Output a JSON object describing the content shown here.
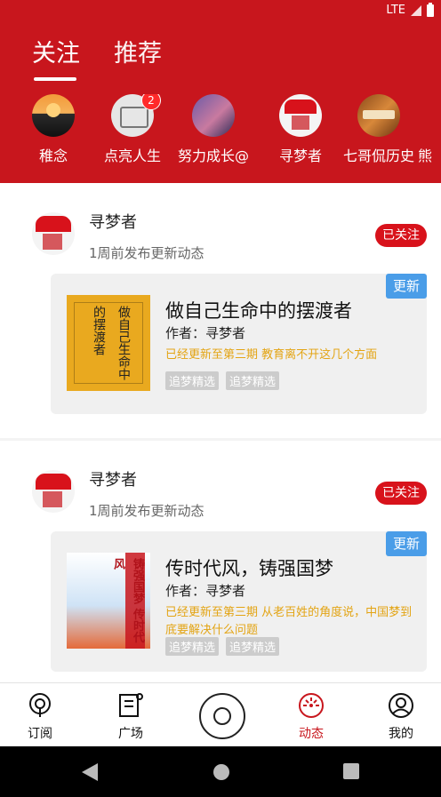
{
  "status": {
    "network": "LTE"
  },
  "tabs": [
    {
      "label": "关注"
    },
    {
      "label": "推荐"
    }
  ],
  "following": [
    {
      "name": "稚念"
    },
    {
      "name": "点亮人生",
      "badge": "2"
    },
    {
      "name": "努力成长@"
    },
    {
      "name": "寻梦者"
    },
    {
      "name": "七哥侃历史"
    },
    {
      "name": "熊"
    }
  ],
  "posts": [
    {
      "user": "寻梦者",
      "time": "1周前发布更新动态",
      "follow_label": "已关注",
      "update_label": "更新",
      "cover_text": "做自己生命中的摆渡者",
      "title": "做自己生命中的摆渡者",
      "author": "作者：寻梦者",
      "desc": "已经更新至第三期   教育离不开这几个方面",
      "tags": [
        "追梦精选",
        "追梦精选"
      ]
    },
    {
      "user": "寻梦者",
      "time": "1周前发布更新动态",
      "follow_label": "已关注",
      "update_label": "更新",
      "cover_text": "铸强国梦 传时代风",
      "title": "传时代风，铸强国梦",
      "author": "作者：寻梦者",
      "desc": "已经更新至第三期   从老百姓的角度说，中国梦到底要解决什么问题",
      "tags": [
        "追梦精选",
        "追梦精选"
      ]
    }
  ],
  "bottom_nav": [
    {
      "label": "订阅",
      "icon": "podcast-icon"
    },
    {
      "label": "广场",
      "icon": "list-icon"
    },
    {
      "label": "",
      "icon": "disc-icon"
    },
    {
      "label": "动态",
      "icon": "activity-icon",
      "active": true
    },
    {
      "label": "我的",
      "icon": "profile-icon"
    }
  ],
  "colors": {
    "brand": "#c8161d",
    "update": "#4a9de8",
    "accent": "#e3a413"
  }
}
